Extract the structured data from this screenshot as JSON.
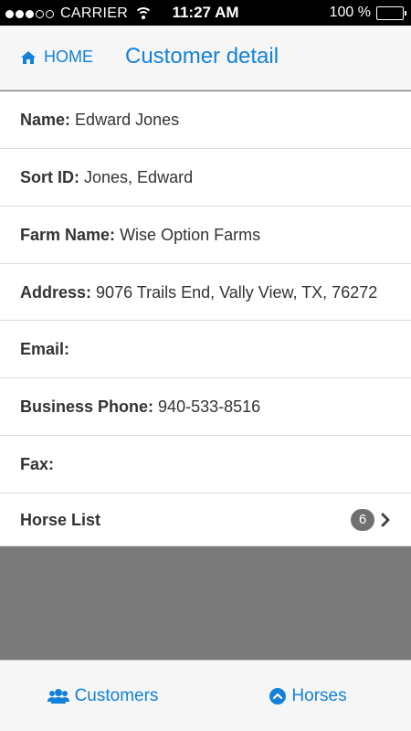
{
  "status_bar": {
    "carrier": "CARRIER",
    "time": "11:27 AM",
    "battery": "100 %",
    "icons": [
      "signal-dots",
      "wifi-icon",
      "battery-icon"
    ]
  },
  "nav": {
    "home_label": "HOME",
    "home_icon": "home-icon",
    "title": "Customer detail"
  },
  "customer": {
    "name_label": "Name:",
    "name": "Edward Jones",
    "sort_id_label": "Sort ID:",
    "sort_id": "Jones, Edward",
    "farm_label": "Farm Name:",
    "farm": "Wise Option Farms",
    "address_label": "Address:",
    "address": "9076 Trails End, Vally View, TX, 76272",
    "email_label": "Email:",
    "email": "",
    "phone_label": "Business Phone:",
    "phone": "940-533-8516",
    "fax_label": "Fax:",
    "fax": ""
  },
  "horse_list": {
    "label": "Horse List",
    "count": "6",
    "icon": "chevron-right-icon"
  },
  "tabs": [
    {
      "label": "Customers",
      "icon": "users-icon"
    },
    {
      "label": "Horses",
      "icon": "chevron-up-circle-icon"
    }
  ],
  "colors": {
    "accent": "#1481da",
    "badge": "#707070",
    "background": "#7a7a7a"
  }
}
